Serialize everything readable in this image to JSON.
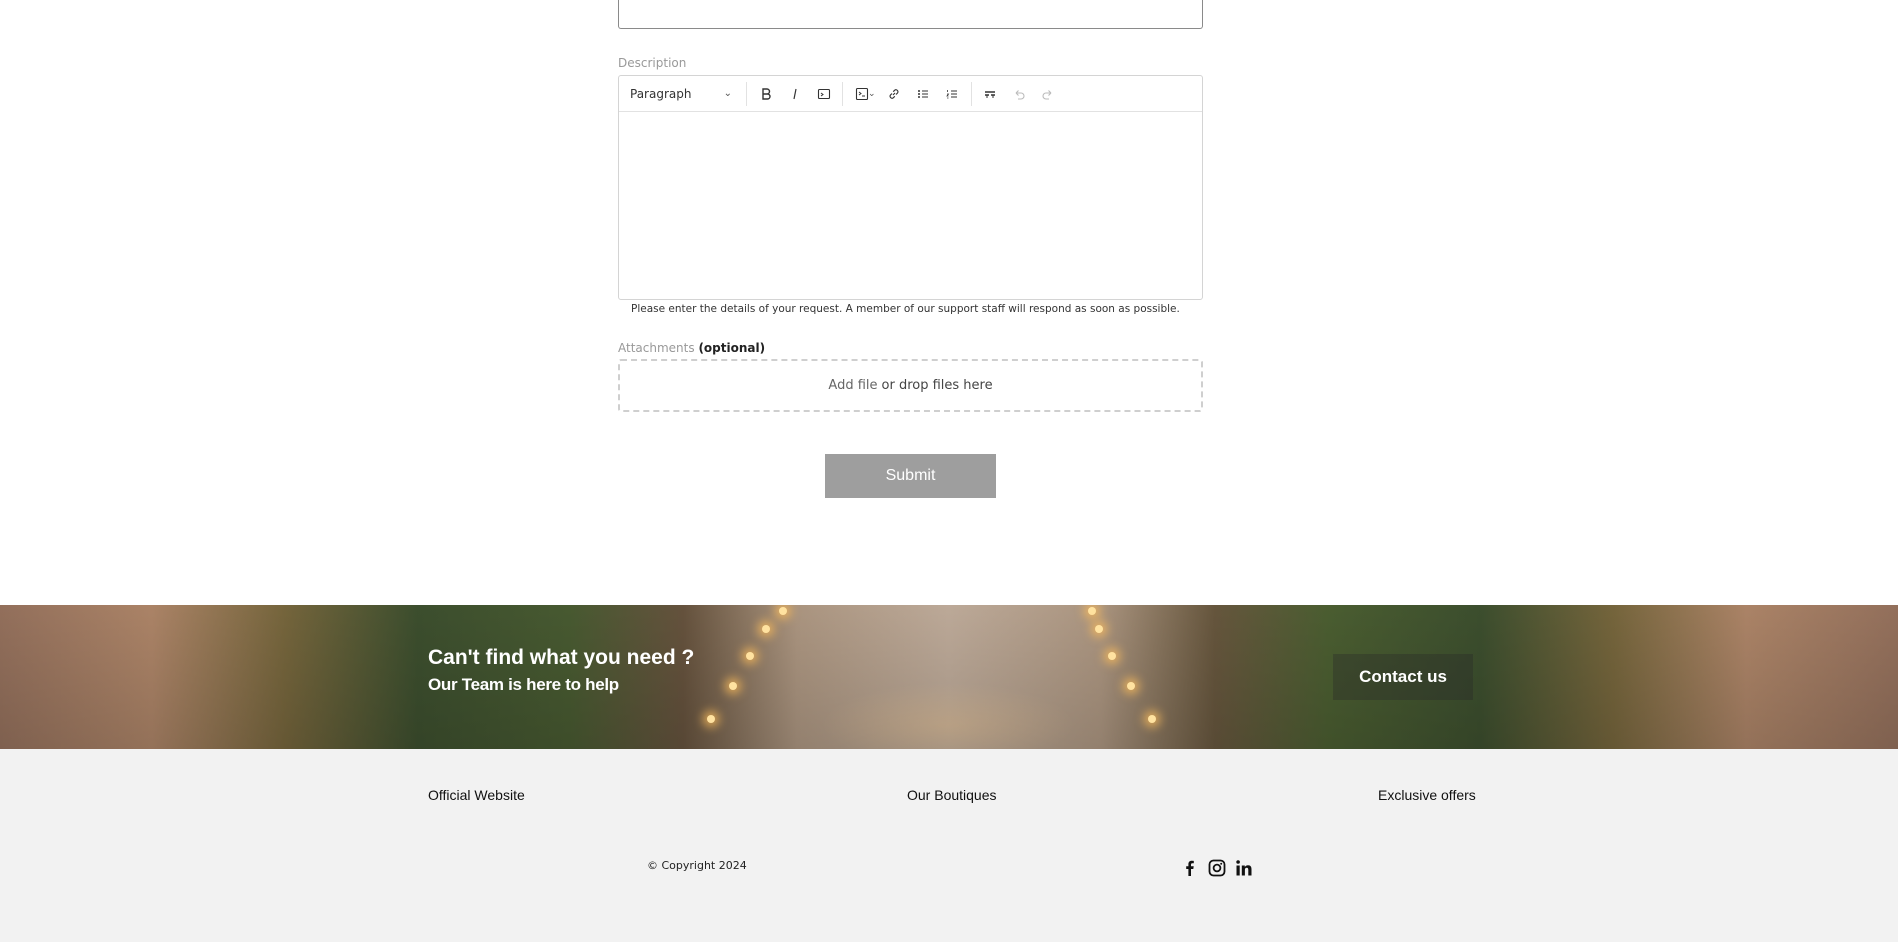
{
  "form": {
    "description_label": "Description",
    "toolbar": {
      "block_format": "Paragraph",
      "buttons": [
        "bold",
        "italic",
        "code",
        "code-block",
        "link",
        "bulleted-list",
        "numbered-list",
        "blockquote",
        "undo",
        "redo"
      ]
    },
    "description_hint": "Please enter the details of your request. A member of our support staff will respond as soon as possible.",
    "attachments_label": "Attachments",
    "attachments_optional": "(optional)",
    "dropzone_add": "Add file",
    "dropzone_rest": "or drop files here",
    "submit_label": "Submit"
  },
  "banner": {
    "title": "Can't find what you need ?",
    "subtitle": "Our Team is here to help",
    "contact_label": "Contact us"
  },
  "footer": {
    "links": [
      "Official Website",
      "Our Boutiques",
      "Exclusive offers"
    ],
    "copyright": "© Copyright 2024",
    "social": [
      "facebook-icon",
      "instagram-icon",
      "linkedin-icon"
    ]
  },
  "colors": {
    "submit_bg": "#9e9e9e",
    "footer_bg": "#f2f2f2",
    "label_gray": "#999999"
  }
}
